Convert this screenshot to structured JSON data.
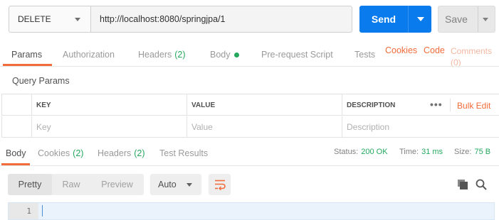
{
  "request": {
    "method": "DELETE",
    "url": "http://localhost:8080/springjpa/1",
    "send_label": "Send",
    "save_label": "Save"
  },
  "request_tabs": [
    {
      "label": "Params",
      "active": true
    },
    {
      "label": "Authorization"
    },
    {
      "label": "Headers",
      "count": "(2)"
    },
    {
      "label": "Body"
    },
    {
      "label": "Pre-request Script"
    },
    {
      "label": "Tests"
    }
  ],
  "request_links": {
    "cookies": "Cookies",
    "code": "Code",
    "comments": "Comments",
    "comments_count": "(0)"
  },
  "query_params": {
    "title": "Query Params",
    "columns": [
      "KEY",
      "VALUE",
      "DESCRIPTION"
    ],
    "placeholders": [
      "Key",
      "Value",
      "Description"
    ],
    "more": "•••",
    "bulk_edit": "Bulk Edit"
  },
  "response_tabs": [
    {
      "label": "Body",
      "active": true
    },
    {
      "label": "Cookies",
      "count": "(2)"
    },
    {
      "label": "Headers",
      "count": "(2)"
    },
    {
      "label": "Test Results"
    }
  ],
  "response_status": {
    "status_label": "Status:",
    "status_value": "200 OK",
    "time_label": "Time:",
    "time_value": "31 ms",
    "size_label": "Size:",
    "size_value": "75 B"
  },
  "response_view": {
    "modes": [
      "Pretty",
      "Raw",
      "Preview"
    ],
    "active_mode": "Pretty",
    "format": "Auto"
  },
  "editor": {
    "line_number": "1"
  },
  "colors": {
    "accent_orange": "#f26b3a",
    "send_blue": "#097bed",
    "status_green": "#25a85e"
  },
  "icons": {
    "wrap": "wrap-lines-icon",
    "copy": "copy-icon",
    "search": "search-icon"
  }
}
